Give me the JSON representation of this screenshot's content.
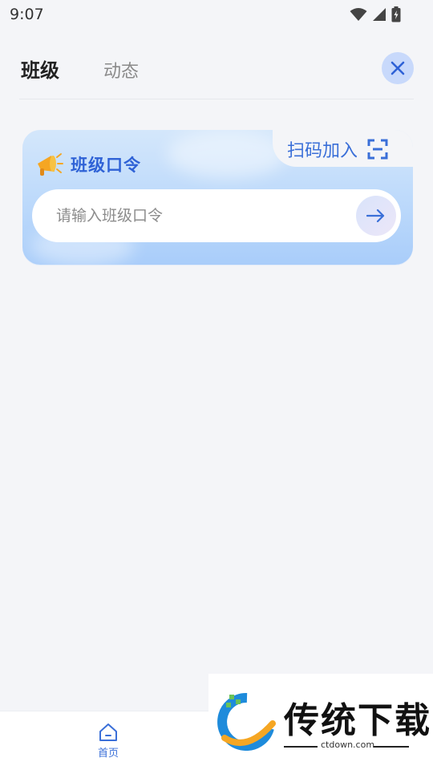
{
  "status_bar": {
    "time": "9:07"
  },
  "header": {
    "tabs": [
      {
        "label": "班级",
        "active": true
      },
      {
        "label": "动态",
        "active": false
      }
    ]
  },
  "card": {
    "title": "班级口令",
    "scan_label": "扫码加入",
    "input_placeholder": "请输入班级口令",
    "input_value": ""
  },
  "bottom_nav": {
    "items": [
      {
        "label": "首页",
        "icon": "home-icon",
        "active": true
      }
    ]
  },
  "watermark": {
    "brand": "传统下载",
    "url": "ctdown.com"
  },
  "colors": {
    "accent": "#3a6fd8",
    "background": "#f4f5f8",
    "close_bg": "#c8d9fb"
  }
}
